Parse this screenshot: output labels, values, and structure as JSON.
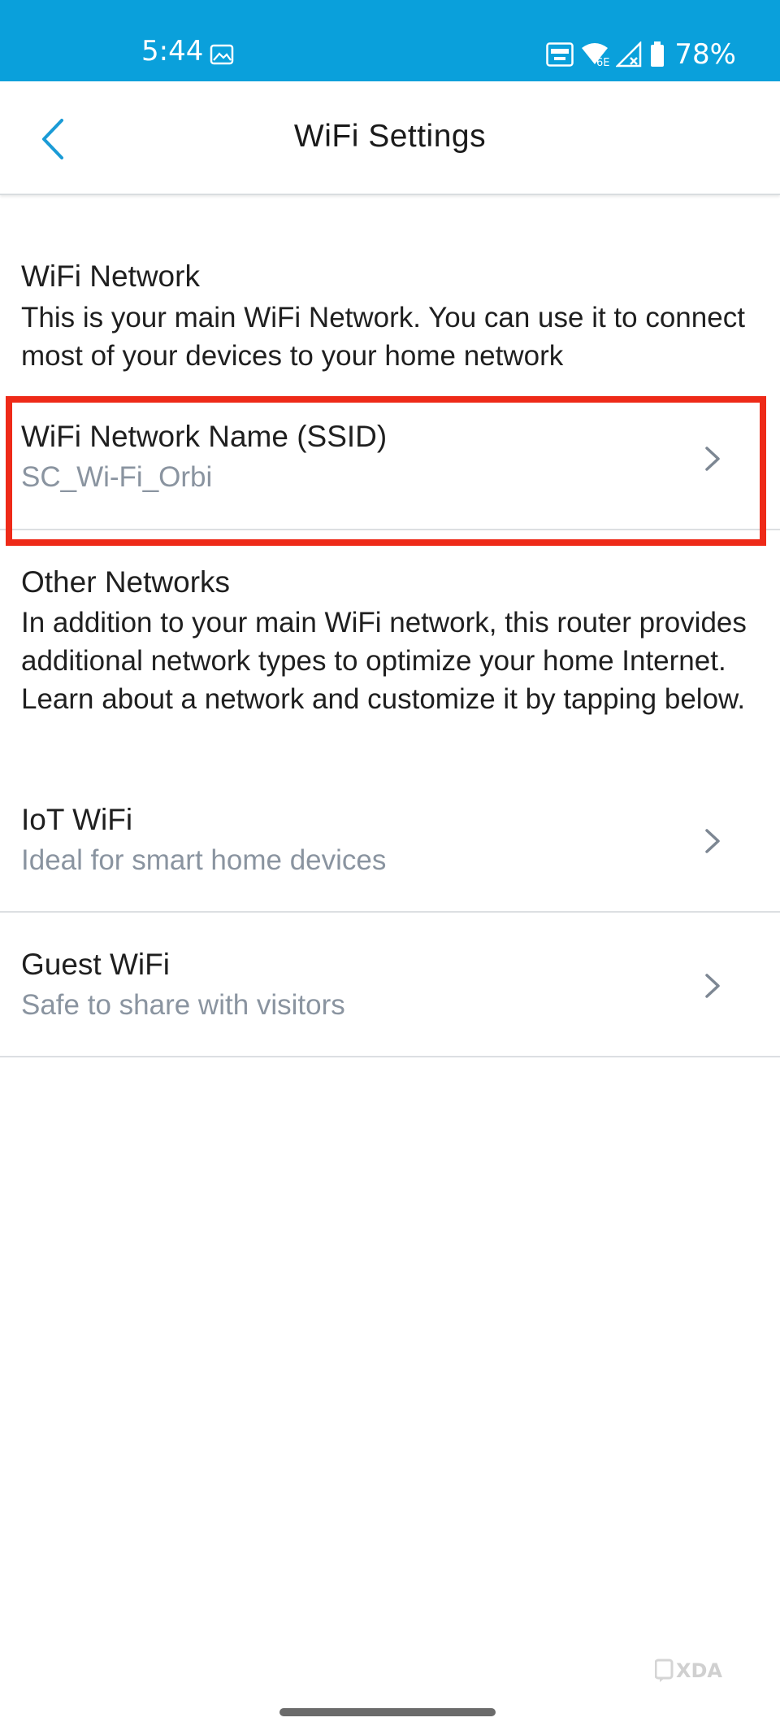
{
  "status_bar": {
    "time": "5:44",
    "battery": "78%",
    "network_badge": "6E",
    "background": "#0aa0db",
    "icons": [
      "gallery-icon",
      "auto-hz-icon",
      "wifi-6e-icon",
      "no-signal-icon",
      "battery-icon"
    ]
  },
  "header": {
    "title": "WiFi Settings",
    "back_icon": "chevron-left-icon",
    "accent": "#1a9bd6"
  },
  "wifi_network": {
    "title": "WiFi Network",
    "description": "This is your main WiFi Network. You can use it to connect most of your devices to your home network"
  },
  "ssid_row": {
    "label": "WiFi Network Name (SSID)",
    "value": "SC_Wi-Fi_Orbi"
  },
  "other_networks": {
    "title": "Other Networks",
    "description": "In addition to your main WiFi network, this router provides additional network types to optimize your home Internet. Learn about a network and customize it by tapping below."
  },
  "iot_row": {
    "label": "IoT WiFi",
    "value": "Ideal for smart home devices"
  },
  "guest_row": {
    "label": "Guest WiFi",
    "value": "Safe to share with visitors"
  },
  "annotation": {
    "highlight_color": "#ee2a18"
  },
  "watermark": {
    "text": "XDA"
  }
}
